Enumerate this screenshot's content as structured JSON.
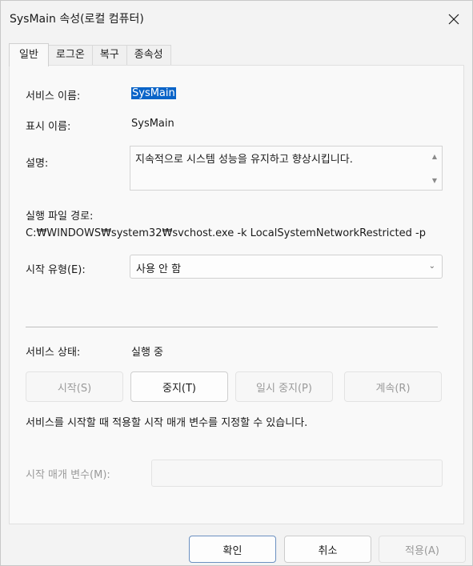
{
  "window": {
    "title": "SysMain 속성(로컬 컴퓨터)",
    "close_icon": "close-icon"
  },
  "tabs": [
    {
      "label": "일반",
      "active": true
    },
    {
      "label": "로그온",
      "active": false
    },
    {
      "label": "복구",
      "active": false
    },
    {
      "label": "종속성",
      "active": false
    }
  ],
  "general": {
    "service_name_label": "서비스 이름:",
    "service_name_value": "SysMain",
    "display_name_label": "표시 이름:",
    "display_name_value": "SysMain",
    "description_label": "설명:",
    "description_value": "지속적으로 시스템 성능을 유지하고 향상시킵니다.",
    "exe_path_label": "실행 파일 경로:",
    "exe_path_value": "C:₩WINDOWS₩system32₩svchost.exe -k LocalSystemNetworkRestricted -p",
    "startup_type_label": "시작 유형(E):",
    "startup_type_value": "사용 안 함",
    "service_status_label": "서비스 상태:",
    "service_status_value": "실행 중",
    "buttons": {
      "start": "시작(S)",
      "stop": "중지(T)",
      "pause": "일시 중지(P)",
      "resume": "계속(R)"
    },
    "hint_text": "서비스를 시작할 때 적용할 시작 매개 변수를 지정할 수 있습니다.",
    "start_params_label": "시작 매개 변수(M):",
    "start_params_value": ""
  },
  "footer": {
    "ok": "확인",
    "cancel": "취소",
    "apply": "적용(A)"
  },
  "colors": {
    "selection": "#0a64c8",
    "dialog_bg": "#f3f3f3",
    "panel_bg": "#f9f9f9"
  }
}
